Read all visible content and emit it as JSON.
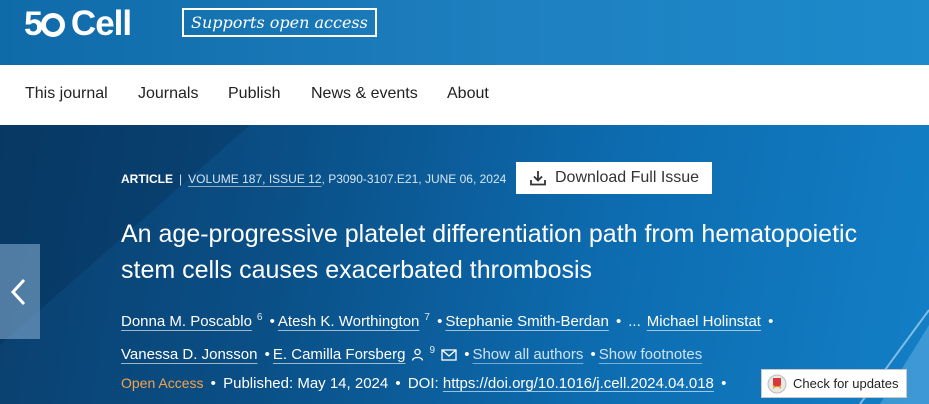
{
  "header": {
    "logo_number": "5",
    "logo_name": "Cell",
    "open_access_badge": "Supports open access"
  },
  "nav": {
    "items": [
      {
        "label": "This journal"
      },
      {
        "label": "Journals"
      },
      {
        "label": "Publish"
      },
      {
        "label": "News & events"
      },
      {
        "label": "About"
      }
    ]
  },
  "article": {
    "type": "ARTICLE",
    "separator": "|",
    "volume": "VOLUME 187, ISSUE 12",
    "pages_date": ", P3090-3107.E21, JUNE 06, 2024",
    "download_label": "Download Full Issue",
    "title": "An age-progressive platelet differentiation path from hematopoietic stem cells causes exacerbated thrombosis",
    "authors": [
      {
        "name": "Donna M. Poscablo",
        "sup": "6"
      },
      {
        "name": "Atesh K. Worthington",
        "sup": "7"
      },
      {
        "name": "Stephanie Smith-Berdan"
      },
      {
        "name": "Michael Holinstat"
      },
      {
        "name": "Vanessa D. Jonsson"
      },
      {
        "name": "E. Camilla Forsberg",
        "sup": "9"
      }
    ],
    "bullet": "•",
    "ellipsis": "...",
    "show_all_authors": "Show all authors",
    "show_footnotes": "Show footnotes",
    "open_access": "Open Access",
    "published": "Published: May 14, 2024",
    "doi_label": "DOI:",
    "doi": "https://doi.org/10.1016/j.cell.2024.04.018",
    "check_updates": "Check for updates"
  },
  "colors": {
    "header_blue": "#1c80c0",
    "hero_dark": "#0a3f6e",
    "open_access_orange": "#f3a34f"
  },
  "icons": [
    "download-icon",
    "chevron-left-icon",
    "person-icon",
    "mail-icon",
    "crossmark-icon"
  ]
}
